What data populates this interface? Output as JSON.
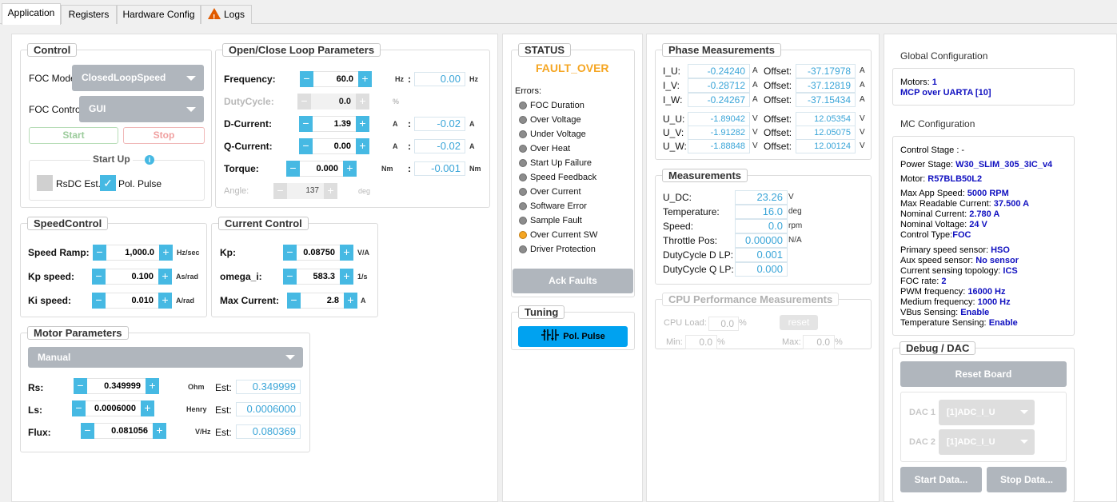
{
  "tabs": [
    "Application",
    "Registers",
    "Hardware Config",
    "Logs"
  ],
  "control": {
    "title": "Control",
    "foc_mode_label": "FOC Mode",
    "foc_mode_value": "ClosedLoopSpeed",
    "foc_control_label": "FOC Control",
    "foc_control_value": "GUI",
    "start": "Start",
    "stop": "Stop",
    "startup_title": "Start Up",
    "rsdc": "RsDC Est.",
    "polpulse": "Pol. Pulse"
  },
  "loop": {
    "title": "Open/Close Loop Parameters",
    "frequency": {
      "label": "Frequency:",
      "value": "60.0",
      "unit": "Hz",
      "ro": "0.00",
      "ro_unit": "Hz"
    },
    "dutycycle": {
      "label": "DutyCycle:",
      "value": "0.0",
      "unit": "%"
    },
    "dcurrent": {
      "label": "D-Current:",
      "value": "1.39",
      "unit": "A",
      "ro": "-0.02",
      "ro_unit": "A"
    },
    "qcurrent": {
      "label": "Q-Current:",
      "value": "0.00",
      "unit": "A",
      "ro": "-0.02",
      "ro_unit": "A"
    },
    "torque": {
      "label": "Torque:",
      "value": "0.000",
      "unit": "Nm",
      "ro": "-0.001",
      "ro_unit": "Nm"
    },
    "angle": {
      "label": "Angle:",
      "value": "137",
      "unit": "deg"
    },
    "colon": ":"
  },
  "speed": {
    "title": "SpeedControl",
    "ramp": {
      "label": "Speed Ramp:",
      "value": "1,000.0",
      "unit": "Hz/sec"
    },
    "kp": {
      "label": "Kp speed:",
      "value": "0.100",
      "unit": "As/rad"
    },
    "ki": {
      "label": "Ki speed:",
      "value": "0.010",
      "unit": "A/rad"
    }
  },
  "current": {
    "title": "Current Control",
    "kp": {
      "label": "Kp:",
      "value": "0.08750",
      "unit": "V/A"
    },
    "omega": {
      "label": "omega_i:",
      "value": "583.3",
      "unit": "1/s"
    },
    "max": {
      "label": "Max Current:",
      "value": "2.8",
      "unit": "A"
    }
  },
  "motor": {
    "title": "Motor Parameters",
    "mode": "Manual",
    "est": "Est:",
    "rs": {
      "label": "Rs:",
      "value": "0.349999",
      "unit": "Ohm",
      "est": "0.349999"
    },
    "ls": {
      "label": "Ls:",
      "value": "0.0006000",
      "unit": "Henry",
      "est": "0.0006000"
    },
    "flux": {
      "label": "Flux:",
      "value": "0.081056",
      "unit": "V/Hz",
      "est": "0.080369"
    }
  },
  "status": {
    "title": "STATUS",
    "state": "FAULT_OVER",
    "errors_label": "Errors:",
    "errors": [
      {
        "label": "FOC Duration",
        "on": false
      },
      {
        "label": "Over Voltage",
        "on": false
      },
      {
        "label": "Under Voltage",
        "on": false
      },
      {
        "label": "Over Heat",
        "on": false
      },
      {
        "label": "Start Up Failure",
        "on": false
      },
      {
        "label": "Speed Feedback",
        "on": false
      },
      {
        "label": "Over Current",
        "on": false
      },
      {
        "label": "Software Error",
        "on": false
      },
      {
        "label": "Sample Fault",
        "on": false
      },
      {
        "label": "Over Current SW",
        "on": true
      },
      {
        "label": "Driver Protection",
        "on": false
      }
    ],
    "ack": "Ack Faults"
  },
  "tuning": {
    "title": "Tuning",
    "polpulse": "Pol. Pulse"
  },
  "phase": {
    "title": "Phase Measurements",
    "offset_label": "Offset:",
    "currents": [
      {
        "label": "I_U:",
        "value": "-0.24240",
        "unit": "A",
        "offset": "-37.17978",
        "ounit": "A"
      },
      {
        "label": "I_V:",
        "value": "-0.28712",
        "unit": "A",
        "offset": "-37.12819",
        "ounit": "A"
      },
      {
        "label": "I_W:",
        "value": "-0.24267",
        "unit": "A",
        "offset": "-37.15434",
        "ounit": "A"
      }
    ],
    "voltages": [
      {
        "label": "U_U:",
        "value": "-1.89042",
        "unit": "V",
        "offset": "12.05354",
        "ounit": "V"
      },
      {
        "label": "U_V:",
        "value": "-1.91282",
        "unit": "V",
        "offset": "12.05075",
        "ounit": "V"
      },
      {
        "label": "U_W:",
        "value": "-1.88848",
        "unit": "V",
        "offset": "12.00124",
        "ounit": "V"
      }
    ]
  },
  "measurements": {
    "title": "Measurements",
    "rows": [
      {
        "label": "U_DC:",
        "value": "23.26",
        "unit": "V"
      },
      {
        "label": "Temperature:",
        "value": "16.0",
        "unit": "deg"
      },
      {
        "label": "Speed:",
        "value": "0.0",
        "unit": "rpm"
      },
      {
        "label": "Throttle Pos:",
        "value": "0.00000",
        "unit": "N/A"
      },
      {
        "label": "DutyCycle D LP:",
        "value": "0.001",
        "unit": ""
      },
      {
        "label": "DutyCycle Q LP:",
        "value": "0.000",
        "unit": ""
      }
    ]
  },
  "cpu": {
    "title": "CPU Performance Measurements",
    "load_label": "CPU Load:",
    "load": "0.0",
    "pct": "%",
    "reset": "reset",
    "min_label": "Min:",
    "min": "0.0",
    "max_label": "Max:",
    "max": "0.0"
  },
  "global": {
    "title": "Global Configuration",
    "motors_label": "Motors:",
    "motors": "1",
    "link": "MCP over UARTA [10]"
  },
  "mc": {
    "title": "MC Configuration",
    "control_stage": "Control Stage : -",
    "power_stage_label": "Power Stage:",
    "power_stage": "W30_SLIM_305_3IC_v4",
    "motor_label": "Motor:",
    "motor": "R57BLB50L2",
    "max_speed_label": "Max App Speed:",
    "max_speed": "5000 RPM",
    "max_current_label": "Max Readable Current:",
    "max_current": "37.500 A",
    "nom_current_label": "Nominal Current:",
    "nom_current": "2.780 A",
    "nom_voltage_label": "Nominal Voltage:",
    "nom_voltage": "24 V",
    "ctrl_type_label": "Control Type:",
    "ctrl_type": "FOC",
    "primary_label": "Primary speed sensor:",
    "primary": "HSO",
    "aux_label": "Aux speed sensor:",
    "aux": "No sensor",
    "topology_label": "Current sensing topology:",
    "topology": "ICS",
    "focrate_label": "FOC rate:",
    "focrate": "2",
    "pwm_label": "PWM frequency:",
    "pwm": "16000 Hz",
    "medium_label": "Medium frequency:",
    "medium": "1000 Hz",
    "vbus_label": "VBus Sensing:",
    "vbus": "Enable",
    "temp_label": "Temperature Sensing:",
    "temp": "Enable"
  },
  "debug": {
    "title": "Debug / DAC",
    "reset": "Reset Board",
    "dac1_label": "DAC 1",
    "dac1": "[1]ADC_I_U",
    "dac2_label": "DAC 2",
    "dac2": "[1]ADC_I_U",
    "start": "Start Data...",
    "stop": "Stop Data..."
  }
}
